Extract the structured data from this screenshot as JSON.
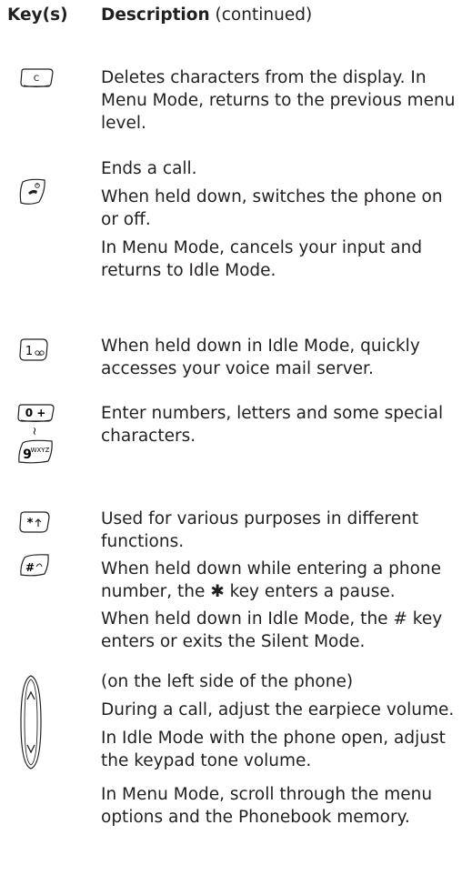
{
  "header": {
    "keys_label": "Key(s)",
    "desc_bold": "Description",
    "desc_suffix": " (continued)"
  },
  "rows": [
    {
      "icon": "clear-key-icon",
      "key_text": "C",
      "lines": [
        "Deletes characters from the display. In Menu Mode, returns to the previous menu level."
      ]
    },
    {
      "icon": "end-power-key-icon",
      "lines": [
        "Ends a call.",
        "When held down, switches the phone on or off.",
        "In Menu Mode, cancels your input and returns to Idle Mode."
      ]
    },
    {
      "icon": "voicemail-1-key-icon",
      "key_text": "1",
      "lines": [
        "When held down in Idle Mode, quickly accesses your voice mail server."
      ]
    },
    {
      "icon": "number-keys-0-to-9-icon",
      "key_text_top": "0 +",
      "key_text_range": "~",
      "key_text_bottom": "9",
      "key_text_bottom_sub": "WXYZ",
      "lines": [
        "Enter numbers, letters and some special characters."
      ]
    },
    {
      "icon": "star-and-hash-keys-icon",
      "key_text_star": "*",
      "key_text_hash": "#",
      "lines": [
        "Used for various purposes in different functions.",
        "When held down while entering a phone number, the ✱ key enters a pause.",
        "When held down in Idle Mode, the # key enters or exits the Silent Mode."
      ]
    },
    {
      "icon": "volume-side-keys-icon",
      "lines": [
        "(on the left side of the phone)",
        "During a call, adjust the earpiece volume.",
        "In Idle Mode with the phone open, adjust the keypad tone volume.",
        "In Menu Mode, scroll through the menu options and the Phonebook memory."
      ]
    }
  ]
}
